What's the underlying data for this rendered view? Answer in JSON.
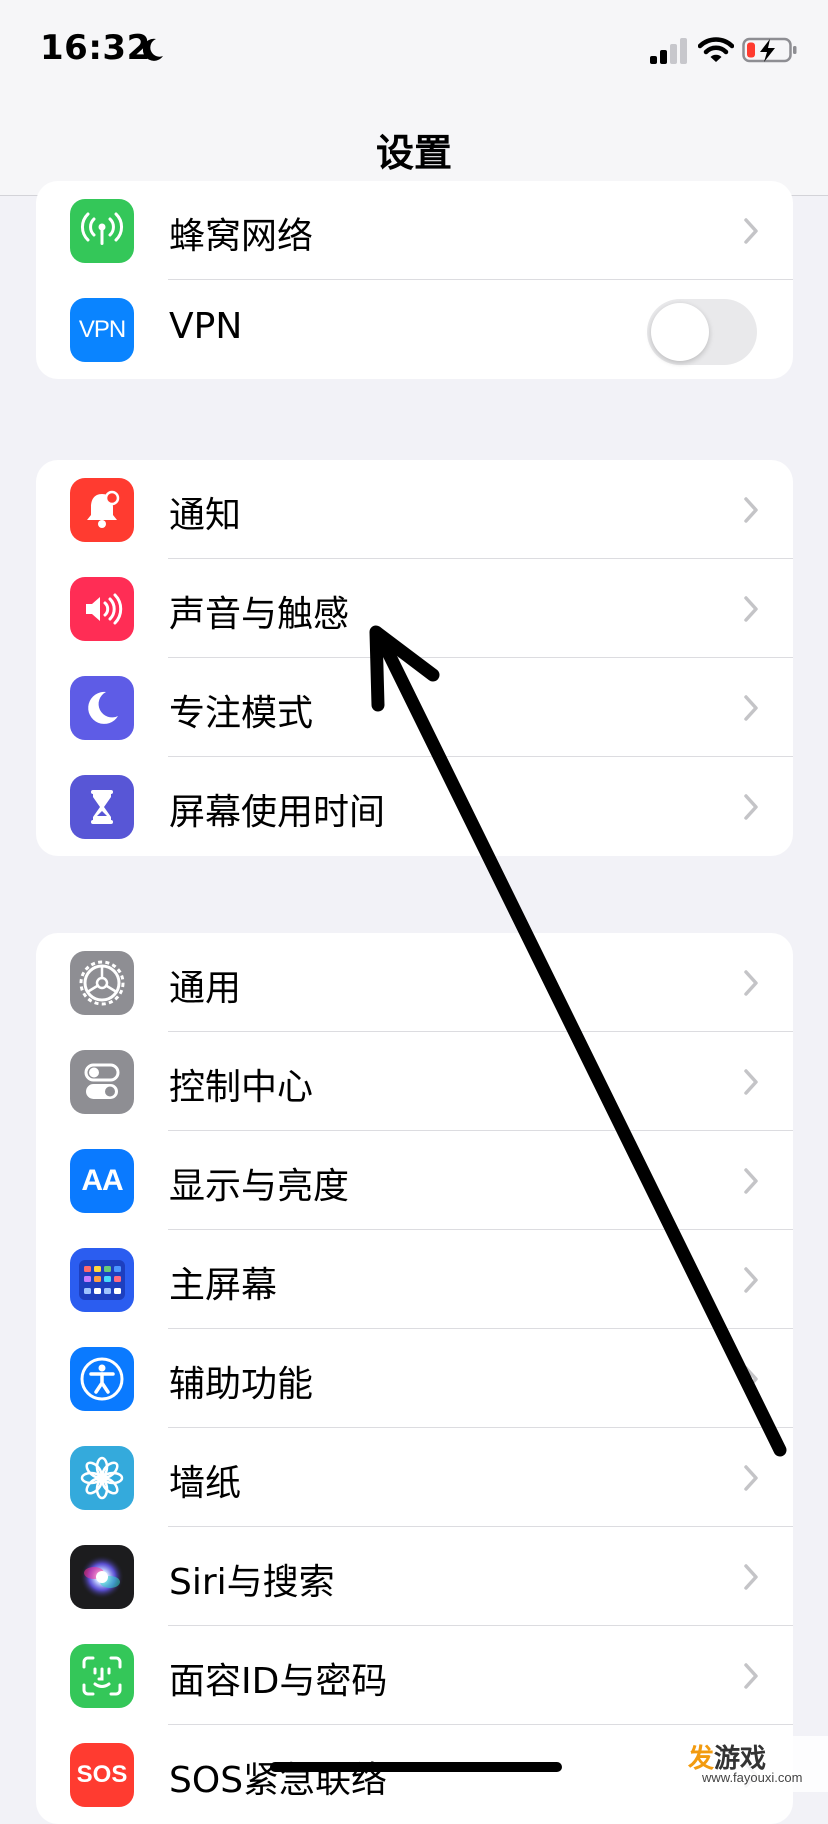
{
  "status_bar": {
    "time": "16:32",
    "focus_icon": "moon-icon",
    "signal_icon": "cellular-signal-icon",
    "wifi_icon": "wifi-icon",
    "battery_icon": "battery-charging-icon"
  },
  "nav": {
    "title": "设置"
  },
  "colors": {
    "cellular": "#34c759",
    "vpn": "#0a84ff",
    "notifications": "#ff3b30",
    "sounds": "#ff2d55",
    "focus": "#5e5ce6",
    "screen_time": "#5856d6",
    "general": "#8e8e93",
    "control_center": "#8e8e93",
    "display": "#0a7aff",
    "home_screen": "#2b5df0",
    "accessibility": "#0a7aff",
    "wallpaper": "#34aadc",
    "siri": "#1c1c1e",
    "face_id": "#34c759",
    "sos": "#ff3b30"
  },
  "groups": [
    {
      "items": [
        {
          "label": "蜂窝网络",
          "icon": "antenna-icon",
          "accessory": "chevron"
        },
        {
          "label": "VPN",
          "icon": "vpn-icon",
          "icon_text": "VPN",
          "accessory": "toggle",
          "toggle_on": false
        }
      ]
    },
    {
      "items": [
        {
          "label": "通知",
          "icon": "bell-icon",
          "accessory": "chevron"
        },
        {
          "label": "声音与触感",
          "icon": "speaker-icon",
          "accessory": "chevron"
        },
        {
          "label": "专注模式",
          "icon": "moon-icon",
          "accessory": "chevron"
        },
        {
          "label": "屏幕使用时间",
          "icon": "hourglass-icon",
          "accessory": "chevron"
        }
      ]
    },
    {
      "items": [
        {
          "label": "通用",
          "icon": "gear-icon",
          "accessory": "chevron"
        },
        {
          "label": "控制中心",
          "icon": "switches-icon",
          "accessory": "chevron"
        },
        {
          "label": "显示与亮度",
          "icon": "text-size-icon",
          "icon_text": "AA",
          "accessory": "chevron"
        },
        {
          "label": "主屏幕",
          "icon": "app-grid-icon",
          "accessory": "chevron"
        },
        {
          "label": "辅助功能",
          "icon": "accessibility-icon",
          "accessory": "chevron"
        },
        {
          "label": "墙纸",
          "icon": "flower-icon",
          "accessory": "chevron"
        },
        {
          "label": "Siri与搜索",
          "icon": "siri-icon",
          "accessory": "chevron"
        },
        {
          "label": "面容ID与密码",
          "icon": "face-id-icon",
          "accessory": "chevron"
        },
        {
          "label": "SOS紧急联络",
          "icon": "sos-icon",
          "icon_text": "SOS",
          "accessory": "chevron"
        }
      ]
    }
  ],
  "annotation": {
    "type": "hand-drawn-arrow",
    "color": "#000000",
    "points_to": "声音与触感"
  },
  "watermark": {
    "brand_accent": "发",
    "brand_rest": "游戏",
    "url": "www.fayouxi.com"
  }
}
